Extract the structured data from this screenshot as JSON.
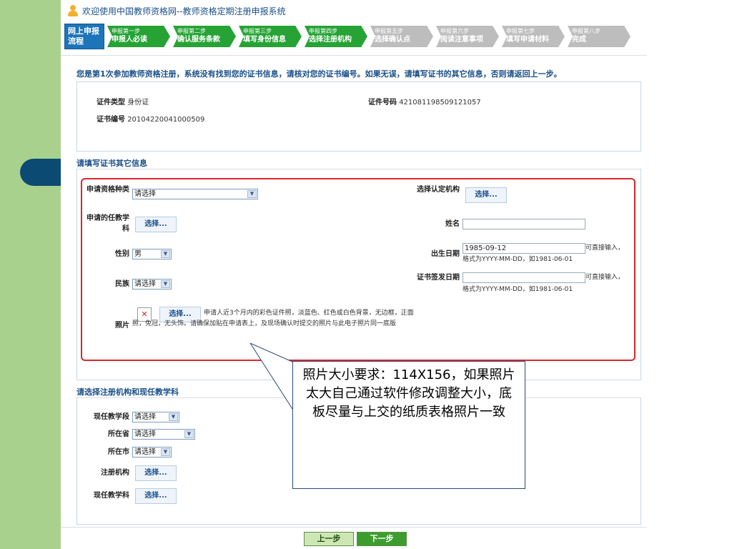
{
  "header": {
    "title": "欢迎使用中国教师资格网--教师资格定期注册申报系统"
  },
  "steps": {
    "first": "网上申报流程",
    "items": [
      {
        "step": "申报第一步",
        "label": "申报人必读",
        "state": "active"
      },
      {
        "step": "申报第二步",
        "label": "确认服务条款",
        "state": "active"
      },
      {
        "step": "申报第三步",
        "label": "填写身份信息",
        "state": "active"
      },
      {
        "step": "申报第四步",
        "label": "选择注册机构",
        "state": "active"
      },
      {
        "step": "申报第五步",
        "label": "选择确认点",
        "state": "inactive"
      },
      {
        "step": "申报第六步",
        "label": "阅读注意事项",
        "state": "inactive"
      },
      {
        "step": "申报第七步",
        "label": "填写申请材料",
        "state": "inactive"
      },
      {
        "step": "申报第八步",
        "label": "完成",
        "state": "inactive"
      }
    ]
  },
  "notice": "您是第1次参加教师资格注册，系统没有找到您的证书信息，请核对您的证书编号。如果无误，请填写证书的其它信息，否则请返回上一步。",
  "certificate": {
    "id_type_label": "证件类型",
    "id_type_value": "身份证",
    "id_number_label": "证件号码",
    "id_number_value": "421081198509121057",
    "cert_no_label": "证书编号",
    "cert_no_value": "20104220041000509"
  },
  "other_info": {
    "section_title": "请填写证书其它信息",
    "qualification_label": "申请资格种类",
    "qualification_value": "请选择",
    "authority_label": "选择认定机构",
    "subject_label": "申请的任教学科",
    "name_label": "姓名",
    "name_value": "",
    "gender_label": "性别",
    "gender_value": "男",
    "birth_label": "出生日期",
    "birth_value": "1985-09-12",
    "birth_hint1": "可直接输入，",
    "birth_hint2": "格式为YYYY-MM-DD，如1981-06-01",
    "ethnicity_label": "民族",
    "ethnicity_value": "请选择",
    "issue_date_label": "证书签发日期",
    "issue_date_value": "",
    "issue_hint1": "可直接输入，",
    "issue_hint2": "格式为YYYY-MM-DD，如1981-06-01",
    "photo_label": "照片",
    "photo_desc": "申请人近3个月内的彩色证件照，淡蓝色、红色或白色背景，无边框，正面照，免冠，无头饰。请确保加贴在申请表上，及现场确认时提交的照片与此电子照片同一底版",
    "choose_label": "选择..."
  },
  "registration": {
    "section_title": "请选择注册机构和现任教学科",
    "stage_label": "现任教学段",
    "stage_value": "请选择",
    "province_label": "所在省",
    "province_value": "请选择",
    "city_label": "所在市",
    "city_value": "请选择",
    "org_label": "注册机构",
    "subject_label": "现任教学科"
  },
  "callout": "照片大小要求：114X156，如果照片太大自己通过软件修改调整大小，底板尽量与上交的纸质表格照片一致",
  "nav": {
    "prev": "上一步",
    "next": "下一步"
  },
  "colors": {
    "active_step": "#27a336",
    "inactive_step": "#bdbdbd",
    "highlight_border": "#d9262b",
    "accent": "#1a4f8a"
  }
}
